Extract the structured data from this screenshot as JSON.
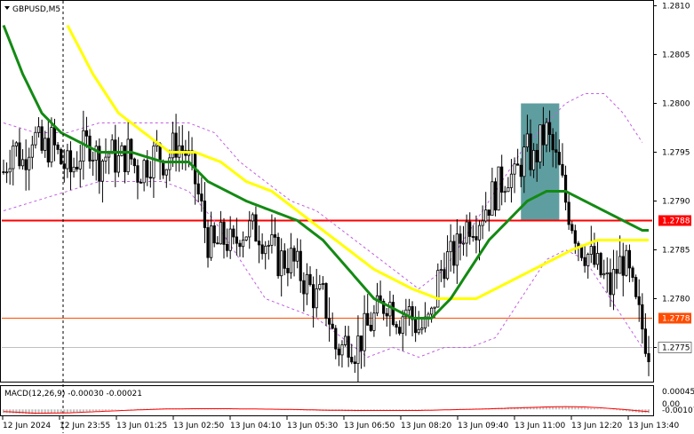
{
  "chart_data": [
    {
      "type": "candlestick",
      "title": "GBPUSD,M5",
      "symbol": "GBPUSD",
      "timeframe": "M5",
      "ylim": [
        1.27715,
        1.28105
      ],
      "y_ticks": [
        1.2775,
        1.278,
        1.2785,
        1.279,
        1.2795,
        1.28,
        1.2805,
        1.281
      ],
      "y_tick_labels": [
        "1.2775",
        "1.2780",
        "1.2785",
        "1.2790",
        "1.2795",
        "1.2800",
        "1.2805",
        "1.2810"
      ],
      "x_tick_labels": [
        "12 Jun 2024",
        "12 Jun 23:55",
        "13 Jun 01:25",
        "13 Jun 02:50",
        "13 Jun 04:10",
        "13 Jun 05:30",
        "13 Jun 06:50",
        "13 Jun 08:20",
        "13 Jun 09:40",
        "13 Jun 11:00",
        "13 Jun 12:20",
        "13 Jun 13:40"
      ],
      "candle_color": "#000000",
      "price_path": [
        [
          0,
          1.2793
        ],
        [
          3,
          1.2796
        ],
        [
          6,
          1.2794
        ],
        [
          9,
          1.2797
        ],
        [
          12,
          1.2795
        ],
        [
          15,
          1.2796
        ],
        [
          18,
          1.2794
        ],
        [
          21,
          1.2793
        ],
        [
          24,
          1.2795
        ],
        [
          27,
          1.2796
        ],
        [
          30,
          1.2794
        ],
        [
          33,
          1.2795
        ],
        [
          36,
          1.2794
        ],
        [
          39,
          1.2795
        ],
        [
          42,
          1.2793
        ],
        [
          45,
          1.2794
        ],
        [
          48,
          1.2795
        ],
        [
          51,
          1.2794
        ],
        [
          54,
          1.2796
        ],
        [
          57,
          1.2795
        ],
        [
          60,
          1.2792
        ],
        [
          62,
          1.2789
        ],
        [
          64,
          1.2786
        ],
        [
          66,
          1.2785
        ],
        [
          68,
          1.2786
        ],
        [
          70,
          1.2786
        ],
        [
          72,
          1.2785
        ],
        [
          74,
          1.2787
        ],
        [
          76,
          1.2787
        ],
        [
          78,
          1.2787
        ],
        [
          80,
          1.2787
        ],
        [
          82,
          1.2786
        ],
        [
          84,
          1.2785
        ],
        [
          86,
          1.2784
        ],
        [
          88,
          1.2784
        ],
        [
          90,
          1.2784
        ],
        [
          92,
          1.2783
        ],
        [
          94,
          1.2782
        ],
        [
          96,
          1.2781
        ],
        [
          98,
          1.278
        ],
        [
          100,
          1.278
        ],
        [
          102,
          1.2778
        ],
        [
          104,
          1.2775
        ],
        [
          106,
          1.2775
        ],
        [
          108,
          1.2776
        ],
        [
          110,
          1.2775
        ],
        [
          112,
          1.2776
        ],
        [
          114,
          1.2777
        ],
        [
          116,
          1.2778
        ],
        [
          118,
          1.2779
        ],
        [
          120,
          1.278
        ],
        [
          122,
          1.2779
        ],
        [
          124,
          1.2778
        ],
        [
          126,
          1.2779
        ],
        [
          128,
          1.2778
        ],
        [
          130,
          1.2777
        ],
        [
          132,
          1.2777
        ],
        [
          134,
          1.2778
        ],
        [
          136,
          1.2782
        ],
        [
          138,
          1.2784
        ],
        [
          140,
          1.2784
        ],
        [
          142,
          1.2785
        ],
        [
          144,
          1.2787
        ],
        [
          146,
          1.2788
        ],
        [
          148,
          1.2788
        ],
        [
          150,
          1.2789
        ],
        [
          152,
          1.279
        ],
        [
          154,
          1.2791
        ],
        [
          156,
          1.2792
        ],
        [
          158,
          1.2793
        ],
        [
          160,
          1.2792
        ],
        [
          162,
          1.2794
        ],
        [
          164,
          1.2795
        ],
        [
          166,
          1.2794
        ],
        [
          168,
          1.2796
        ],
        [
          170,
          1.2797
        ],
        [
          172,
          1.2795
        ],
        [
          174,
          1.2793
        ],
        [
          176,
          1.279
        ],
        [
          178,
          1.2788
        ],
        [
          180,
          1.2786
        ],
        [
          182,
          1.2785
        ],
        [
          184,
          1.2784
        ],
        [
          186,
          1.2783
        ],
        [
          188,
          1.2782
        ],
        [
          190,
          1.2781
        ],
        [
          192,
          1.2783
        ],
        [
          194,
          1.2784
        ],
        [
          196,
          1.2782
        ],
        [
          198,
          1.2779
        ],
        [
          200,
          1.2777
        ],
        [
          202,
          1.2775
        ]
      ],
      "green_ma": [
        [
          0,
          1.2808
        ],
        [
          6,
          1.2803
        ],
        [
          12,
          1.2799
        ],
        [
          18,
          1.2797
        ],
        [
          24,
          1.2796
        ],
        [
          30,
          1.2795
        ],
        [
          40,
          1.2795
        ],
        [
          50,
          1.2794
        ],
        [
          58,
          1.2794
        ],
        [
          64,
          1.2792
        ],
        [
          70,
          1.2791
        ],
        [
          76,
          1.279
        ],
        [
          84,
          1.2789
        ],
        [
          92,
          1.2788
        ],
        [
          100,
          1.2786
        ],
        [
          108,
          1.2783
        ],
        [
          116,
          1.278
        ],
        [
          122,
          1.2779
        ],
        [
          128,
          1.2778
        ],
        [
          134,
          1.2778
        ],
        [
          140,
          1.278
        ],
        [
          146,
          1.2783
        ],
        [
          152,
          1.2786
        ],
        [
          158,
          1.2788
        ],
        [
          164,
          1.279
        ],
        [
          170,
          1.2791
        ],
        [
          176,
          1.2791
        ],
        [
          182,
          1.279
        ],
        [
          188,
          1.2789
        ],
        [
          194,
          1.2788
        ],
        [
          200,
          1.2787
        ],
        [
          202,
          1.2787
        ]
      ],
      "yellow_ma": [
        [
          20,
          1.2808
        ],
        [
          28,
          1.2803
        ],
        [
          36,
          1.2799
        ],
        [
          44,
          1.2797
        ],
        [
          52,
          1.2795
        ],
        [
          60,
          1.2795
        ],
        [
          68,
          1.2794
        ],
        [
          76,
          1.2792
        ],
        [
          84,
          1.2791
        ],
        [
          92,
          1.2789
        ],
        [
          100,
          1.2787
        ],
        [
          108,
          1.2785
        ],
        [
          116,
          1.2783
        ],
        [
          122,
          1.2782
        ],
        [
          128,
          1.2781
        ],
        [
          136,
          1.278
        ],
        [
          142,
          1.278
        ],
        [
          148,
          1.278
        ],
        [
          154,
          1.2781
        ],
        [
          160,
          1.2782
        ],
        [
          166,
          1.2783
        ],
        [
          172,
          1.2784
        ],
        [
          178,
          1.2785
        ],
        [
          186,
          1.2786
        ],
        [
          194,
          1.2786
        ],
        [
          200,
          1.2786
        ],
        [
          202,
          1.2786
        ]
      ],
      "bollinger_upper": [
        [
          0,
          1.2798
        ],
        [
          10,
          1.2797
        ],
        [
          20,
          1.2797
        ],
        [
          30,
          1.2798
        ],
        [
          40,
          1.2798
        ],
        [
          50,
          1.2798
        ],
        [
          58,
          1.2798
        ],
        [
          66,
          1.2797
        ],
        [
          74,
          1.2794
        ],
        [
          82,
          1.2792
        ],
        [
          90,
          1.279
        ],
        [
          98,
          1.2789
        ],
        [
          106,
          1.2787
        ],
        [
          114,
          1.2785
        ],
        [
          122,
          1.2783
        ],
        [
          130,
          1.2781
        ],
        [
          138,
          1.2783
        ],
        [
          146,
          1.2787
        ],
        [
          154,
          1.2791
        ],
        [
          162,
          1.2795
        ],
        [
          170,
          1.2798
        ],
        [
          176,
          1.28
        ],
        [
          182,
          1.2801
        ],
        [
          188,
          1.2801
        ],
        [
          194,
          1.2799
        ],
        [
          200,
          1.2796
        ]
      ],
      "bollinger_lower": [
        [
          0,
          1.2789
        ],
        [
          10,
          1.279
        ],
        [
          20,
          1.2791
        ],
        [
          30,
          1.2792
        ],
        [
          40,
          1.2792
        ],
        [
          50,
          1.2792
        ],
        [
          58,
          1.2791
        ],
        [
          66,
          1.2788
        ],
        [
          74,
          1.2784
        ],
        [
          82,
          1.278
        ],
        [
          90,
          1.2779
        ],
        [
          98,
          1.2778
        ],
        [
          106,
          1.2776
        ],
        [
          114,
          1.2774
        ],
        [
          122,
          1.2775
        ],
        [
          130,
          1.2774
        ],
        [
          138,
          1.2775
        ],
        [
          146,
          1.2775
        ],
        [
          154,
          1.2776
        ],
        [
          162,
          1.278
        ],
        [
          170,
          1.2784
        ],
        [
          176,
          1.2785
        ],
        [
          182,
          1.2784
        ],
        [
          188,
          1.2781
        ],
        [
          194,
          1.2778
        ],
        [
          200,
          1.2775
        ]
      ],
      "hlines": [
        {
          "price": 1.2788,
          "label": "1.2788",
          "color": "#ff0000",
          "width": 2
        },
        {
          "price": 1.2778,
          "label": "1.2778",
          "color": "#ff4c00",
          "width": 1
        },
        {
          "price": 1.2775,
          "label": "1.2775",
          "color": "#c0c0c0",
          "width": 1
        }
      ],
      "highlight_zone": {
        "x_start": 162,
        "x_end": 174,
        "y_low": 1.2788,
        "y_high": 1.28,
        "color": "#5f9ea0"
      },
      "bar_count": 203
    },
    {
      "type": "histogram",
      "title": "MACD(12,26,9) -0.00030 -0.00021",
      "indicator": "MACD(12,26,9)",
      "values_text": "-0.00030 -0.00021",
      "ylim": [
        -0.00017,
        0.00064
      ],
      "y_ticks": [
        0.00045,
        0.0,
        -0.00107
      ],
      "y_tick_labels": [
        "0.00045",
        "0.00",
        "-0.00107"
      ],
      "histogram_color": "#c0c0c0",
      "signal_color": "#ff0000",
      "histogram": [
        [
          0,
          -0.0001
        ],
        [
          10,
          -0.00014
        ],
        [
          20,
          -9e-05
        ],
        [
          30,
          -4e-05
        ],
        [
          40,
          1e-05
        ],
        [
          50,
          3e-05
        ],
        [
          60,
          3e-05
        ],
        [
          70,
          2e-05
        ],
        [
          80,
          0.0
        ],
        [
          90,
          -2e-05
        ],
        [
          100,
          -4e-05
        ],
        [
          110,
          -5e-05
        ],
        [
          120,
          -4e-05
        ],
        [
          130,
          -2e-05
        ],
        [
          140,
          1e-05
        ],
        [
          150,
          3e-05
        ],
        [
          160,
          6e-05
        ],
        [
          170,
          8e-05
        ],
        [
          176,
          8e-05
        ],
        [
          182,
          5e-05
        ],
        [
          188,
          1e-05
        ],
        [
          194,
          -4e-05
        ],
        [
          200,
          -0.0001
        ]
      ],
      "signal": [
        [
          0,
          -6e-05
        ],
        [
          10,
          -0.00011
        ],
        [
          20,
          -0.0001
        ],
        [
          30,
          -6e-05
        ],
        [
          40,
          -2e-05
        ],
        [
          50,
          1e-05
        ],
        [
          60,
          2e-05
        ],
        [
          70,
          2e-05
        ],
        [
          80,
          1e-05
        ],
        [
          90,
          0.0
        ],
        [
          100,
          -2e-05
        ],
        [
          110,
          -3e-05
        ],
        [
          120,
          -3e-05
        ],
        [
          130,
          -3e-05
        ],
        [
          140,
          -1e-05
        ],
        [
          150,
          1e-05
        ],
        [
          160,
          4e-05
        ],
        [
          170,
          7e-05
        ],
        [
          176,
          8e-05
        ],
        [
          182,
          7e-05
        ],
        [
          188,
          4e-05
        ],
        [
          194,
          0.0
        ],
        [
          200,
          -5e-05
        ],
        [
          202,
          -6e-05
        ]
      ]
    }
  ]
}
